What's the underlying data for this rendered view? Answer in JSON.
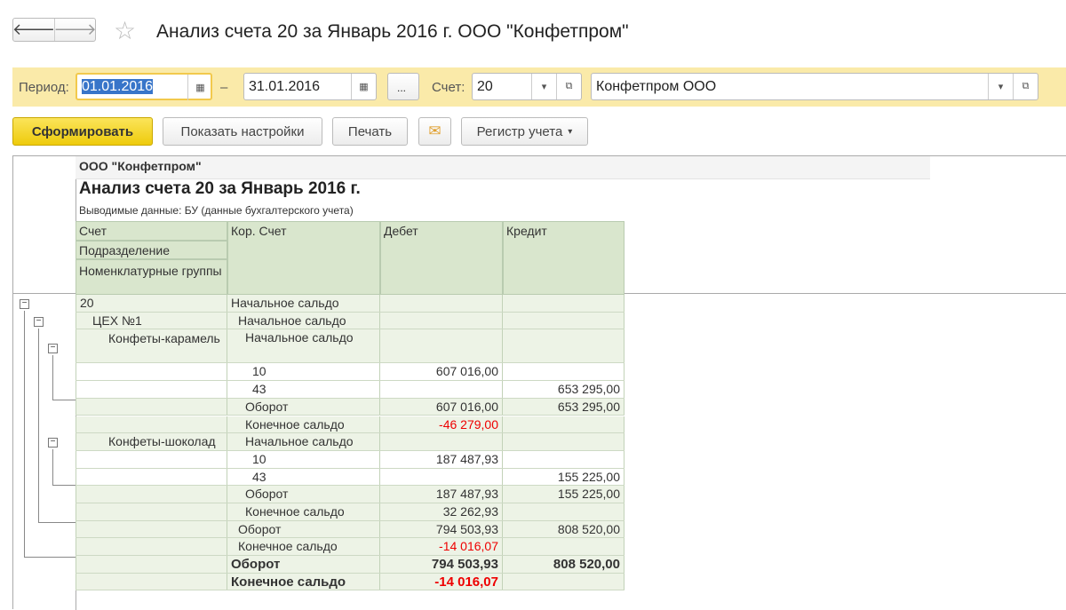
{
  "window": {
    "title": "Анализ счета 20 за Январь 2016 г. ООО \"Конфетпром\"",
    "back": "🡐",
    "forward": "🡒",
    "star": "☆"
  },
  "filters": {
    "period_label": "Период:",
    "date_from": "01.01.2016",
    "dash": "–",
    "date_to": "31.01.2016",
    "more": "...",
    "account_label": "Счет:",
    "account": "20",
    "organization": "Конфетпром ООО"
  },
  "toolbar": {
    "generate": "Сформировать",
    "settings": "Показать настройки",
    "print": "Печать",
    "register": "Регистр учета"
  },
  "report": {
    "org": "ООО \"Конфетпром\"",
    "title": "Анализ счета 20 за Январь 2016 г.",
    "output": "Выводимые данные:  БУ (данные бухгалтерского учета)",
    "headers": {
      "account": "Счет",
      "division": "Подразделение",
      "nomenclature": "Номенклатурные группы",
      "corr": "Кор. Счет",
      "debit": "Дебет",
      "credit": "Кредит"
    },
    "rows": [
      {
        "c1": "20",
        "c2": "Начальное сальдо",
        "c3": "",
        "c4": "",
        "i1": 0,
        "i2": 0
      },
      {
        "c1": "ЦЕХ №1",
        "c2": "Начальное сальдо",
        "c3": "",
        "c4": "",
        "i1": 14,
        "i2": 8
      },
      {
        "c1": "Конфеты-карамель",
        "c2": "Начальное сальдо",
        "c3": "",
        "c4": "",
        "i1": 32,
        "i2": 16,
        "tall": true
      },
      {
        "c1": "",
        "c2": "10",
        "c3": "607 016,00",
        "c4": "",
        "i2": 24,
        "white": true
      },
      {
        "c1": "",
        "c2": "43",
        "c3": "",
        "c4": "653 295,00",
        "i2": 24,
        "white": true
      },
      {
        "c1": "",
        "c2": "Оборот",
        "c3": "607 016,00",
        "c4": "653 295,00",
        "i2": 16
      },
      {
        "c1": "",
        "c2": "Конечное сальдо",
        "c3": "-46 279,00",
        "c4": "",
        "i2": 16,
        "red": true
      },
      {
        "c1": "Конфеты-шоколад",
        "c2": "Начальное сальдо",
        "c3": "",
        "c4": "",
        "i1": 32,
        "i2": 16
      },
      {
        "c1": "",
        "c2": "10",
        "c3": "187 487,93",
        "c4": "",
        "i2": 24,
        "white": true
      },
      {
        "c1": "",
        "c2": "43",
        "c3": "",
        "c4": "155 225,00",
        "i2": 24,
        "white": true
      },
      {
        "c1": "",
        "c2": "Оборот",
        "c3": "187 487,93",
        "c4": "155 225,00",
        "i2": 16
      },
      {
        "c1": "",
        "c2": "Конечное сальдо",
        "c3": "32 262,93",
        "c4": "",
        "i2": 16
      },
      {
        "c1": "",
        "c2": "Оборот",
        "c3": "794 503,93",
        "c4": "808 520,00",
        "i2": 8
      },
      {
        "c1": "",
        "c2": "Конечное сальдо",
        "c3": "-14 016,07",
        "c4": "",
        "i2": 8,
        "red": true
      },
      {
        "c1": "",
        "c2": "Оборот",
        "c3": "794 503,93",
        "c4": "808 520,00",
        "i2": 0,
        "bold": true
      },
      {
        "c1": "",
        "c2": "Конечное сальдо",
        "c3": "-14 016,07",
        "c4": "",
        "i2": 0,
        "bold": true,
        "red": true
      }
    ]
  },
  "colors": {
    "accent": "#faeaa9",
    "header": "#d9e6cd",
    "negative": "#e00000"
  }
}
